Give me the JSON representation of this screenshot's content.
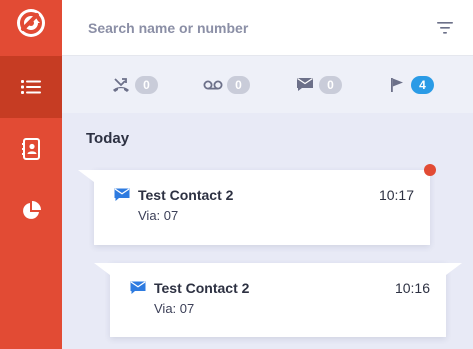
{
  "colors": {
    "rail": "#e24b34",
    "rail_active": "#c63c23",
    "accent_blue": "#2a9be6",
    "badge_grey": "#c9ccd9",
    "unread": "#e24b34"
  },
  "rail": {
    "logo_icon": "app-logo-icon",
    "items": [
      {
        "name": "conversations",
        "icon": "list-icon",
        "active": true
      },
      {
        "name": "contacts",
        "icon": "contact-book-icon",
        "active": false
      },
      {
        "name": "reports",
        "icon": "pie-chart-icon",
        "active": false
      }
    ]
  },
  "search": {
    "placeholder": "Search name or number",
    "value": ""
  },
  "filter_button_icon": "filter-icon",
  "filters": [
    {
      "name": "missed-calls",
      "icon": "missed-call-icon",
      "count": "0",
      "active": false
    },
    {
      "name": "voicemail",
      "icon": "voicemail-icon",
      "count": "0",
      "active": false
    },
    {
      "name": "messages",
      "icon": "message-icon",
      "count": "0",
      "active": false
    },
    {
      "name": "flagged",
      "icon": "flag-icon",
      "count": "4",
      "active": true
    }
  ],
  "section": {
    "title": "Today"
  },
  "messages": [
    {
      "contact": "Test Contact 2",
      "time": "10:17",
      "via": "Via: 07",
      "unread": true,
      "icon": "message-icon"
    },
    {
      "contact": "Test Contact 2",
      "time": "10:16",
      "via": "Via: 07",
      "unread": false,
      "icon": "message-icon"
    }
  ]
}
